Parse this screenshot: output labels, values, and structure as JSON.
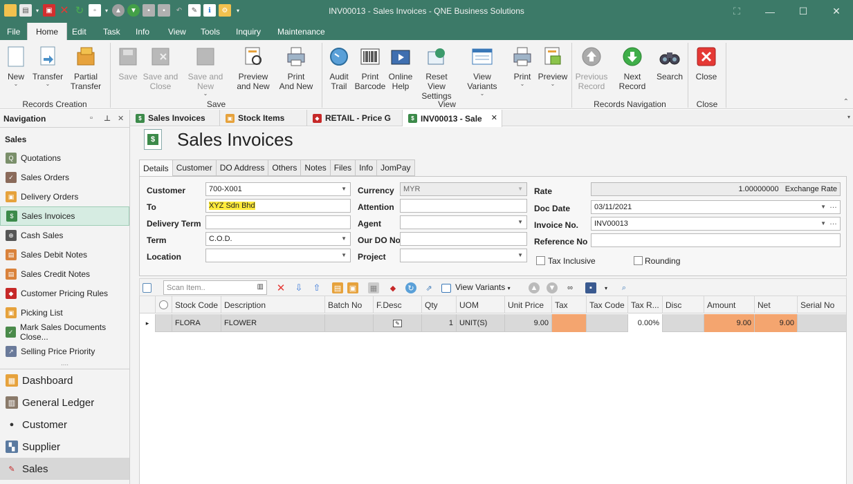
{
  "window": {
    "title": "INV00013 - Sales Invoices - QNE Business Solutions"
  },
  "menu": {
    "file": "File",
    "home": "Home",
    "edit": "Edit",
    "task": "Task",
    "info": "Info",
    "view": "View",
    "tools": "Tools",
    "inquiry": "Inquiry",
    "maintenance": "Maintenance"
  },
  "ribbon": {
    "new": "New",
    "transfer": "Transfer",
    "partial_transfer_1": "Partial",
    "partial_transfer_2": "Transfer",
    "save": "Save",
    "save_close_1": "Save and",
    "save_close_2": "Close",
    "save_new": "Save and New",
    "preview_new_1": "Preview",
    "preview_new_2": "and New",
    "print_new_1": "Print",
    "print_new_2": "And New",
    "audit_1": "Audit",
    "audit_2": "Trail",
    "barcode_1": "Print",
    "barcode_2": "Barcode",
    "help_1": "Online",
    "help_2": "Help",
    "reset_1": "Reset View",
    "reset_2": "Settings",
    "variants": "View Variants",
    "print": "Print",
    "preview": "Preview",
    "prev_1": "Previous",
    "prev_2": "Record",
    "next": "Next Record",
    "search": "Search",
    "close": "Close",
    "groups": {
      "records_creation": "Records Creation",
      "save": "Save",
      "view": "View",
      "records_navigation": "Records Navigation",
      "close": "Close"
    }
  },
  "nav": {
    "header": "Navigation",
    "section": "Sales",
    "items": [
      {
        "label": "Quotations"
      },
      {
        "label": "Sales Orders"
      },
      {
        "label": "Delivery Orders"
      },
      {
        "label": "Sales Invoices"
      },
      {
        "label": "Cash Sales"
      },
      {
        "label": "Sales Debit Notes"
      },
      {
        "label": "Sales Credit Notes"
      },
      {
        "label": "Customer Pricing Rules"
      },
      {
        "label": "Picking List"
      },
      {
        "label": "Mark Sales Documents Close..."
      },
      {
        "label": "Selling Price Priority"
      }
    ],
    "dots": "....",
    "modules": [
      {
        "label": "Dashboard"
      },
      {
        "label": "General Ledger"
      },
      {
        "label": "Customer"
      },
      {
        "label": "Supplier"
      },
      {
        "label": "Sales"
      }
    ]
  },
  "doctabs": [
    {
      "label": "Sales Invoices"
    },
    {
      "label": "Stock Items"
    },
    {
      "label": "RETAIL - Price G"
    },
    {
      "label": "INV00013 - Sale"
    }
  ],
  "page": {
    "title": "Sales Invoices"
  },
  "form_tabs": [
    "Details",
    "Customer",
    "DO Address",
    "Others",
    "Notes",
    "Files",
    "Info",
    "JomPay"
  ],
  "form": {
    "customer_label": "Customer",
    "customer_value": "700-X001",
    "to_label": "To",
    "to_value": "XYZ Sdn Bhd",
    "delivery_term_label": "Delivery Term",
    "delivery_term_value": "",
    "term_label": "Term",
    "term_value": "C.O.D.",
    "location_label": "Location",
    "location_value": "",
    "currency_label": "Currency",
    "currency_value": "MYR",
    "attention_label": "Attention",
    "attention_value": "",
    "agent_label": "Agent",
    "agent_value": "",
    "our_do_label": "Our DO No",
    "our_do_value": "",
    "project_label": "Project",
    "project_value": "",
    "rate_label": "Rate",
    "rate_value": "1.00000000",
    "exchange_rate": "Exchange Rate",
    "doc_date_label": "Doc Date",
    "doc_date_value": "03/11/2021",
    "invoice_no_label": "Invoice No.",
    "invoice_no_value": "INV00013",
    "reference_label": "Reference No",
    "reference_value": "",
    "tax_inclusive": "Tax Inclusive",
    "rounding": "Rounding"
  },
  "grid_toolbar": {
    "scan_placeholder": "Scan Item..",
    "view_variants": "View Variants"
  },
  "grid": {
    "columns": [
      "Stock Code",
      "Description",
      "Batch No",
      "F.Desc",
      "Qty",
      "UOM",
      "Unit Price",
      "Tax",
      "Tax Code",
      "Tax R...",
      "Disc",
      "Amount",
      "Net",
      "Serial No"
    ],
    "row": {
      "stock_code": "FLORA",
      "description": "FLOWER",
      "batch_no": "",
      "qty": "1",
      "uom": "UNIT(S)",
      "unit_price": "9.00",
      "tax": "",
      "tax_code": "",
      "tax_rate": "0.00%",
      "disc": "",
      "amount": "9.00",
      "net": "9.00",
      "serial_no": ""
    }
  },
  "colors": {
    "brand": "#3c7a68",
    "selected_nav": "#d6ece2",
    "highlight_yellow": "#ffeb3b",
    "tax_cell_orange": "#f4a56f"
  }
}
